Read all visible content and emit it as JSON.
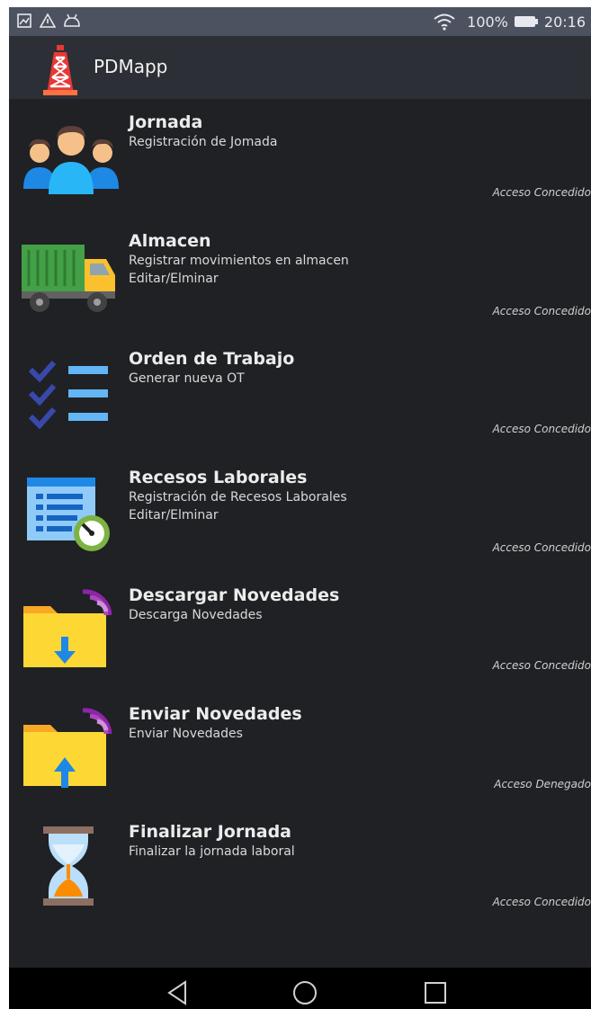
{
  "status": {
    "battery": "100%",
    "time": "20:16"
  },
  "app": {
    "title": "PDMapp"
  },
  "items": [
    {
      "title": "Jornada",
      "desc1": "Registración de Jomada",
      "desc2": "",
      "access": "Acceso Concedido"
    },
    {
      "title": "Almacen",
      "desc1": "Registrar movimientos en almacen",
      "desc2": "Editar/Elminar",
      "access": "Acceso Concedido"
    },
    {
      "title": "Orden de Trabajo",
      "desc1": "Generar nueva OT",
      "desc2": "",
      "access": "Acceso Concedido"
    },
    {
      "title": "Recesos Laborales",
      "desc1": "Registración de Recesos Laborales",
      "desc2": "Editar/Elminar",
      "access": "Acceso Concedido"
    },
    {
      "title": "Descargar Novedades",
      "desc1": "Descarga Novedades",
      "desc2": "",
      "access": "Acceso Concedido"
    },
    {
      "title": "Enviar Novedades",
      "desc1": "Enviar Novedades",
      "desc2": "",
      "access": "Acceso Denegado"
    },
    {
      "title": "Finalizar Jornada",
      "desc1": "Finalizar la jornada laboral",
      "desc2": "",
      "access": "Acceso Concedido"
    }
  ]
}
